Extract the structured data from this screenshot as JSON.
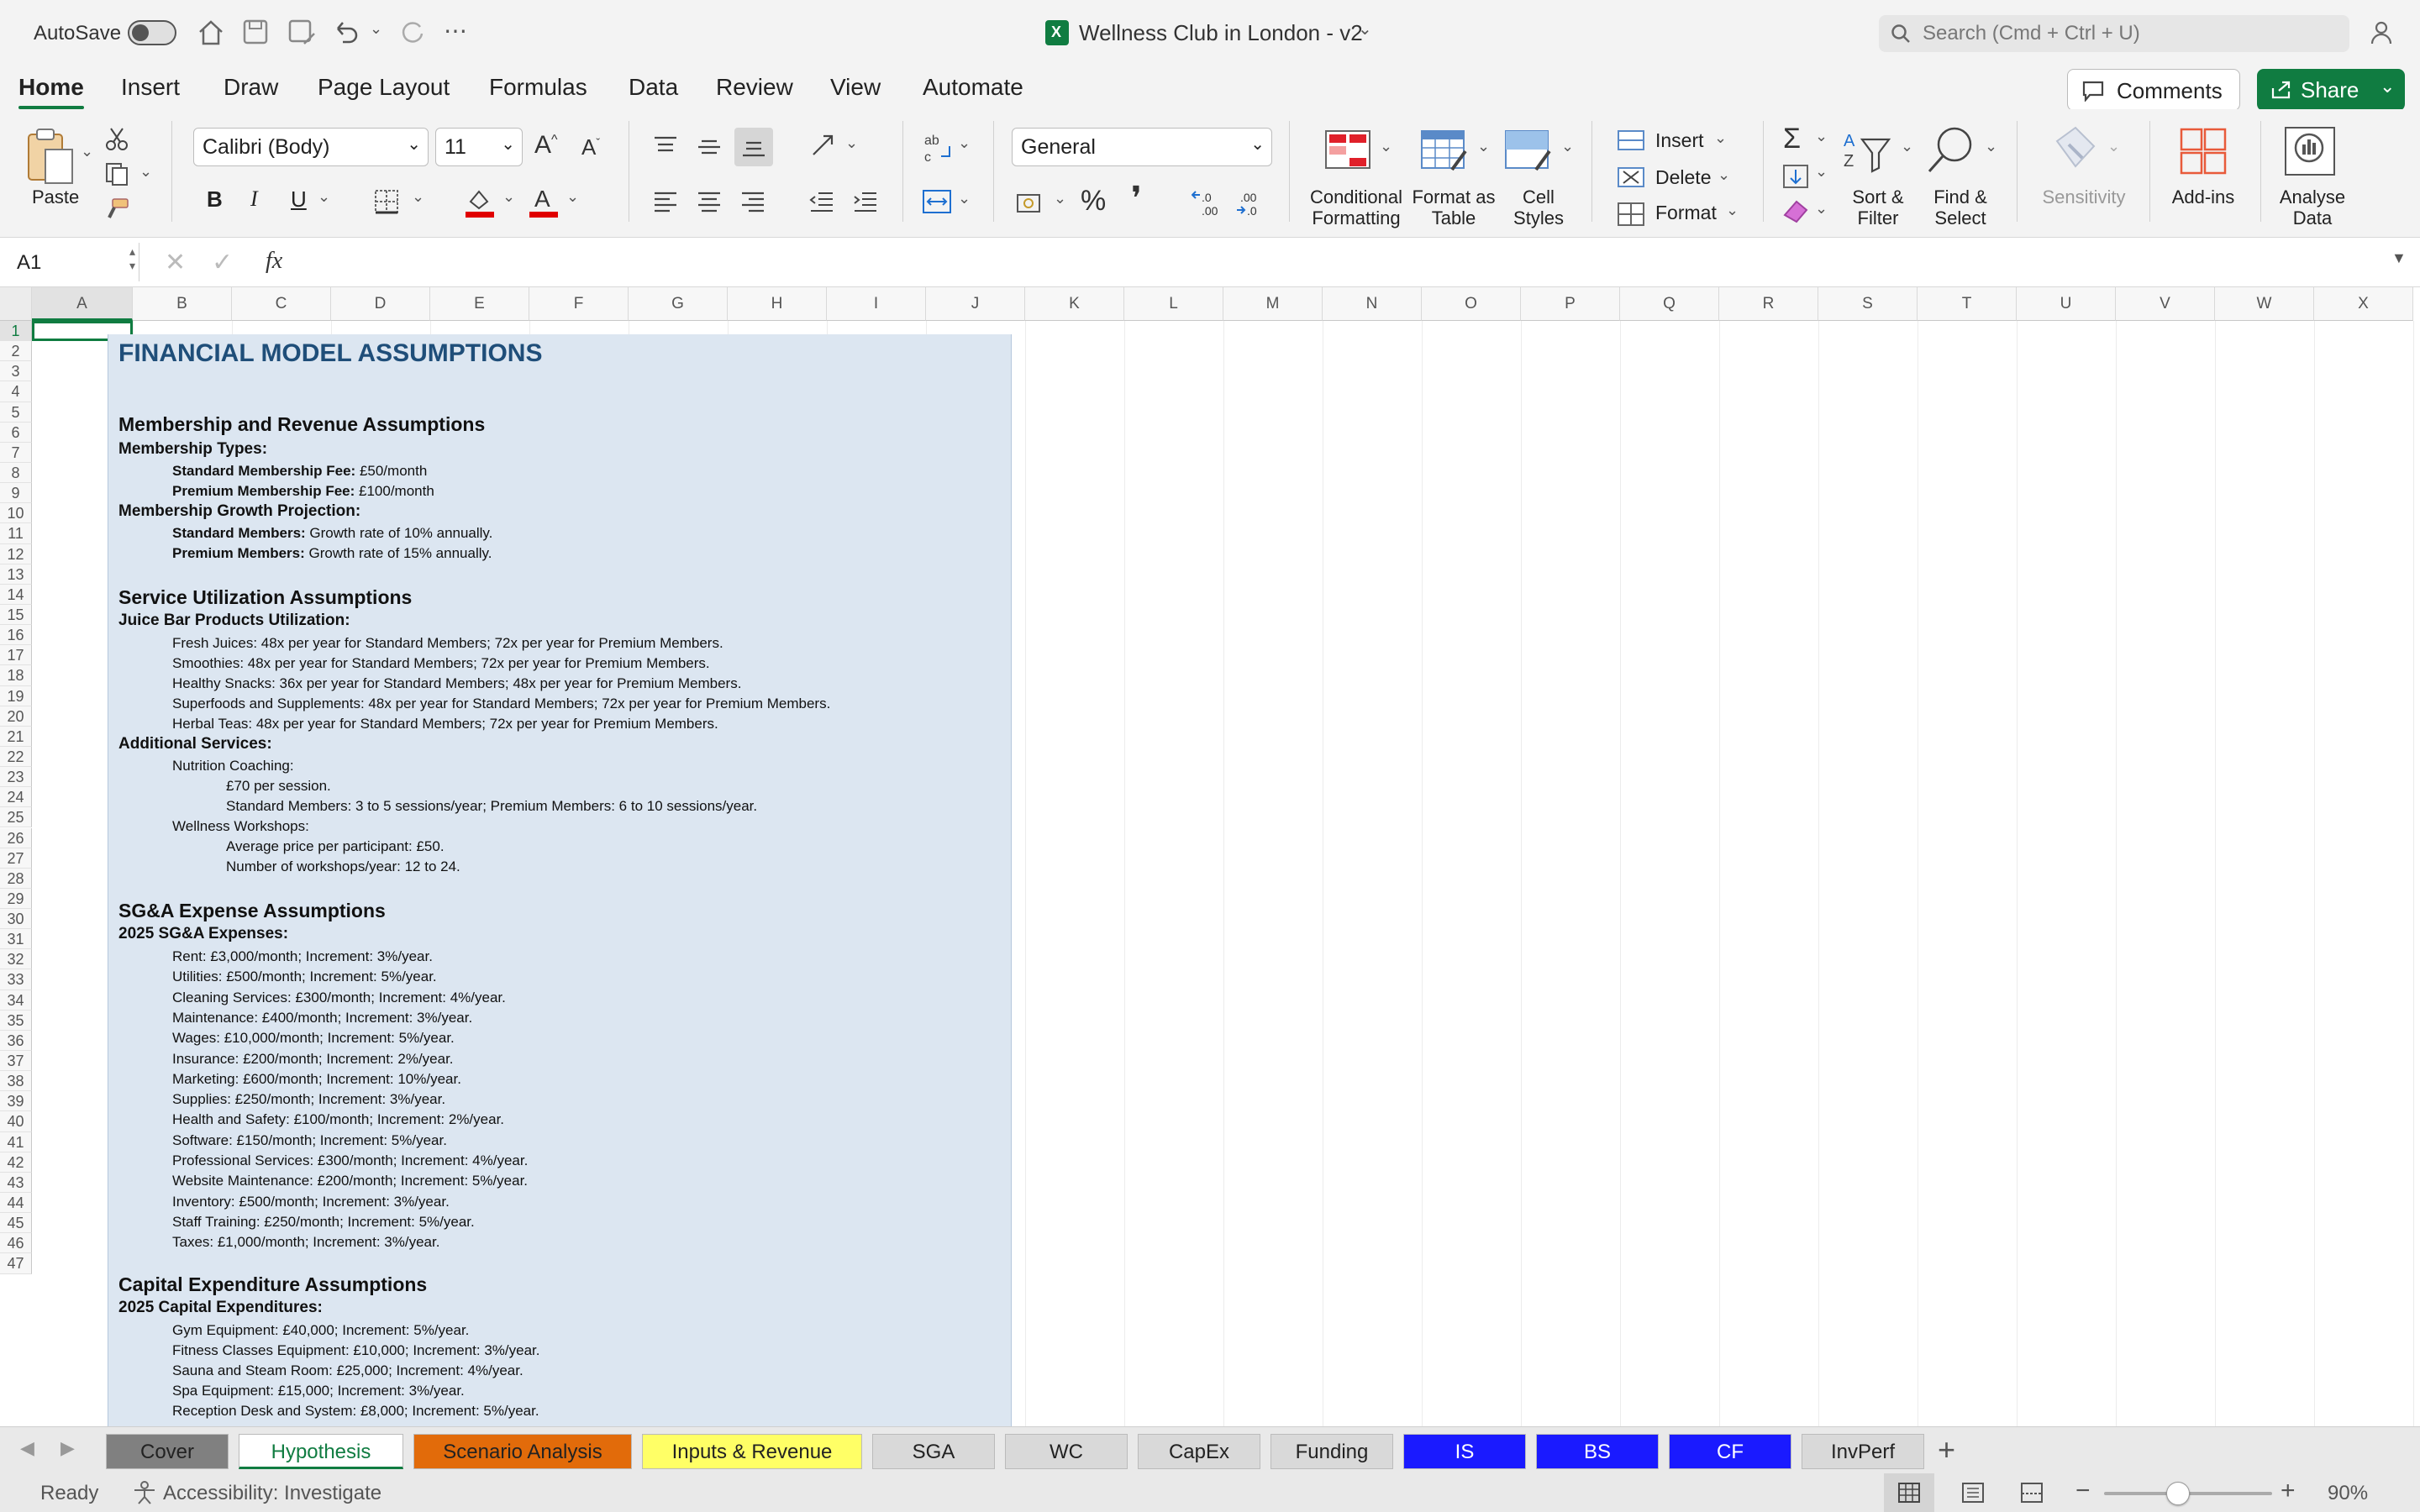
{
  "titlebar": {
    "autosave_label": "AutoSave",
    "doc_title": "Wellness Club in London - v2",
    "search_placeholder": "Search (Cmd + Ctrl + U)"
  },
  "ribbon_tabs": [
    "Home",
    "Insert",
    "Draw",
    "Page Layout",
    "Formulas",
    "Data",
    "Review",
    "View",
    "Automate"
  ],
  "ribbon": {
    "comments_label": "Comments",
    "share_label": "Share",
    "paste_label": "Paste",
    "font_name": "Calibri (Body)",
    "font_size": "11",
    "number_format": "General",
    "conditional_formatting": "Conditional Formatting",
    "format_as_table": "Format as Table",
    "cell_styles": "Cell Styles",
    "insert": "Insert",
    "delete": "Delete",
    "format": "Format",
    "sort_filter": "Sort & Filter",
    "find_select": "Find & Select",
    "sensitivity": "Sensitivity",
    "add_ins": "Add-ins",
    "analyse_data": "Analyse Data",
    "bold": "B",
    "italic": "I",
    "underline": "U",
    "percent": "%",
    "comma": "❜"
  },
  "formula_bar": {
    "name_box": "A1",
    "fx": "fx",
    "formula": ""
  },
  "columns": [
    "A",
    "B",
    "C",
    "D",
    "E",
    "F",
    "G",
    "H",
    "I",
    "J",
    "K",
    "L",
    "M",
    "N",
    "O",
    "P",
    "Q",
    "R",
    "S",
    "T",
    "U",
    "V",
    "W",
    "X"
  ],
  "rows": [
    "1",
    "2",
    "3",
    "4",
    "5",
    "6",
    "7",
    "8",
    "9",
    "10",
    "11",
    "12",
    "13",
    "14",
    "15",
    "16",
    "17",
    "18",
    "19",
    "20",
    "21",
    "22",
    "23",
    "24",
    "25",
    "26",
    "27",
    "28",
    "29",
    "30",
    "31",
    "32",
    "33",
    "34",
    "35",
    "36",
    "37",
    "38",
    "39",
    "40",
    "41",
    "42",
    "43",
    "44",
    "45",
    "46",
    "47"
  ],
  "content": {
    "title": "FINANCIAL MODEL ASSUMPTIONS",
    "s1": "Membership and Revenue Assumptions",
    "s1_sub1": "Membership Types:",
    "s1_i1_b": "Standard Membership Fee:",
    "s1_i1": " £50/month",
    "s1_i2_b": "Premium Membership Fee:",
    "s1_i2": " £100/month",
    "s1_sub2": "Membership Growth Projection:",
    "s1_i3_b": "Standard Members:",
    "s1_i3": " Growth rate of 10% annually.",
    "s1_i4_b": "Premium Members:",
    "s1_i4": " Growth rate of 15% annually.",
    "s2": "Service Utilization Assumptions",
    "s2_sub1": "Juice Bar Products Utilization:",
    "s2_i1": "Fresh Juices: 48x per year for Standard Members; 72x per year for Premium Members.",
    "s2_i2": "Smoothies: 48x per year for Standard Members; 72x per year for Premium Members.",
    "s2_i3": "Healthy Snacks: 36x per year for Standard Members; 48x per year for Premium Members.",
    "s2_i4": "Superfoods and Supplements: 48x per year for Standard Members; 72x per year for Premium Members.",
    "s2_i5": "Herbal Teas: 48x per year for Standard Members; 72x per year for Premium Members.",
    "s2_sub2": "Additional Services:",
    "s2_i6": "Nutrition Coaching:",
    "s2_i7": "£70 per session.",
    "s2_i8": "Standard Members: 3 to 5 sessions/year; Premium Members: 6 to 10 sessions/year.",
    "s2_i9": "Wellness Workshops:",
    "s2_i10": "Average price per participant: £50.",
    "s2_i11": "Number of workshops/year: 12 to 24.",
    "s3": "SG&A Expense Assumptions",
    "s3_sub1": "2025 SG&A Expenses:",
    "s3_items": [
      "Rent: £3,000/month; Increment: 3%/year.",
      "Utilities: £500/month; Increment: 5%/year.",
      "Cleaning Services: £300/month; Increment: 4%/year.",
      "Maintenance: £400/month; Increment: 3%/year.",
      "Wages: £10,000/month; Increment: 5%/year.",
      "Insurance: £200/month; Increment: 2%/year.",
      "Marketing: £600/month; Increment: 10%/year.",
      "Supplies: £250/month; Increment: 3%/year.",
      "Health and Safety: £100/month; Increment: 2%/year.",
      "Software: £150/month; Increment: 5%/year.",
      "Professional Services: £300/month; Increment: 4%/year.",
      "Website Maintenance: £200/month; Increment: 5%/year.",
      "Inventory: £500/month; Increment: 3%/year.",
      "Staff Training: £250/month; Increment: 5%/year.",
      "Taxes: £1,000/month; Increment: 3%/year."
    ],
    "s4": "Capital Expenditure Assumptions",
    "s4_sub1": "2025 Capital Expenditures:",
    "s4_items": [
      "Gym Equipment: £40,000; Increment: 5%/year.",
      "Fitness Classes Equipment: £10,000; Increment: 3%/year.",
      "Sauna and Steam Room: £25,000; Increment: 4%/year.",
      "Spa Equipment: £15,000; Increment: 3%/year.",
      "Reception Desk and System: £8,000; Increment: 5%/year."
    ]
  },
  "sheet_tabs": [
    {
      "label": "Cover",
      "bg": "#808080",
      "fg": "#222222"
    },
    {
      "label": "Hypothesis",
      "bg": "#ffffff",
      "fg": "#107c41"
    },
    {
      "label": "Scenario Analysis",
      "bg": "#e26b0a",
      "fg": "#222222"
    },
    {
      "label": "Inputs & Revenue",
      "bg": "#ffff66",
      "fg": "#222222"
    },
    {
      "label": "SGA",
      "bg": "#d9d9d9",
      "fg": "#222222"
    },
    {
      "label": "WC",
      "bg": "#d9d9d9",
      "fg": "#222222"
    },
    {
      "label": "CapEx",
      "bg": "#d9d9d9",
      "fg": "#222222"
    },
    {
      "label": "Funding",
      "bg": "#d9d9d9",
      "fg": "#222222"
    },
    {
      "label": "IS",
      "bg": "#1a1aff",
      "fg": "#ffffff"
    },
    {
      "label": "BS",
      "bg": "#1a1aff",
      "fg": "#ffffff"
    },
    {
      "label": "CF",
      "bg": "#1a1aff",
      "fg": "#ffffff"
    },
    {
      "label": "InvPerf",
      "bg": "#d9d9d9",
      "fg": "#222222"
    }
  ],
  "status": {
    "ready": "Ready",
    "accessibility": "Accessibility: Investigate",
    "zoom": "90%"
  },
  "colors": {
    "accent": "#107c41",
    "title": "#1f4e79",
    "content_bg": "#dce6f1"
  }
}
